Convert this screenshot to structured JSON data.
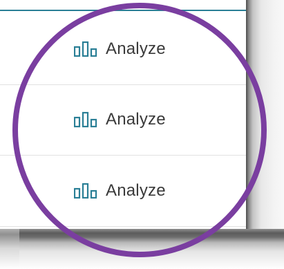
{
  "rows": [
    {
      "action_label": "Analyze",
      "icon": "bar-chart-icon"
    },
    {
      "action_label": "Analyze",
      "icon": "bar-chart-icon"
    },
    {
      "action_label": "Analyze",
      "icon": "bar-chart-icon"
    }
  ],
  "colors": {
    "accent_teal": "#2a7f96",
    "highlight_purple": "#7a3ea0",
    "label_text": "#3a3a3a",
    "row_divider": "#e1e1e1"
  }
}
